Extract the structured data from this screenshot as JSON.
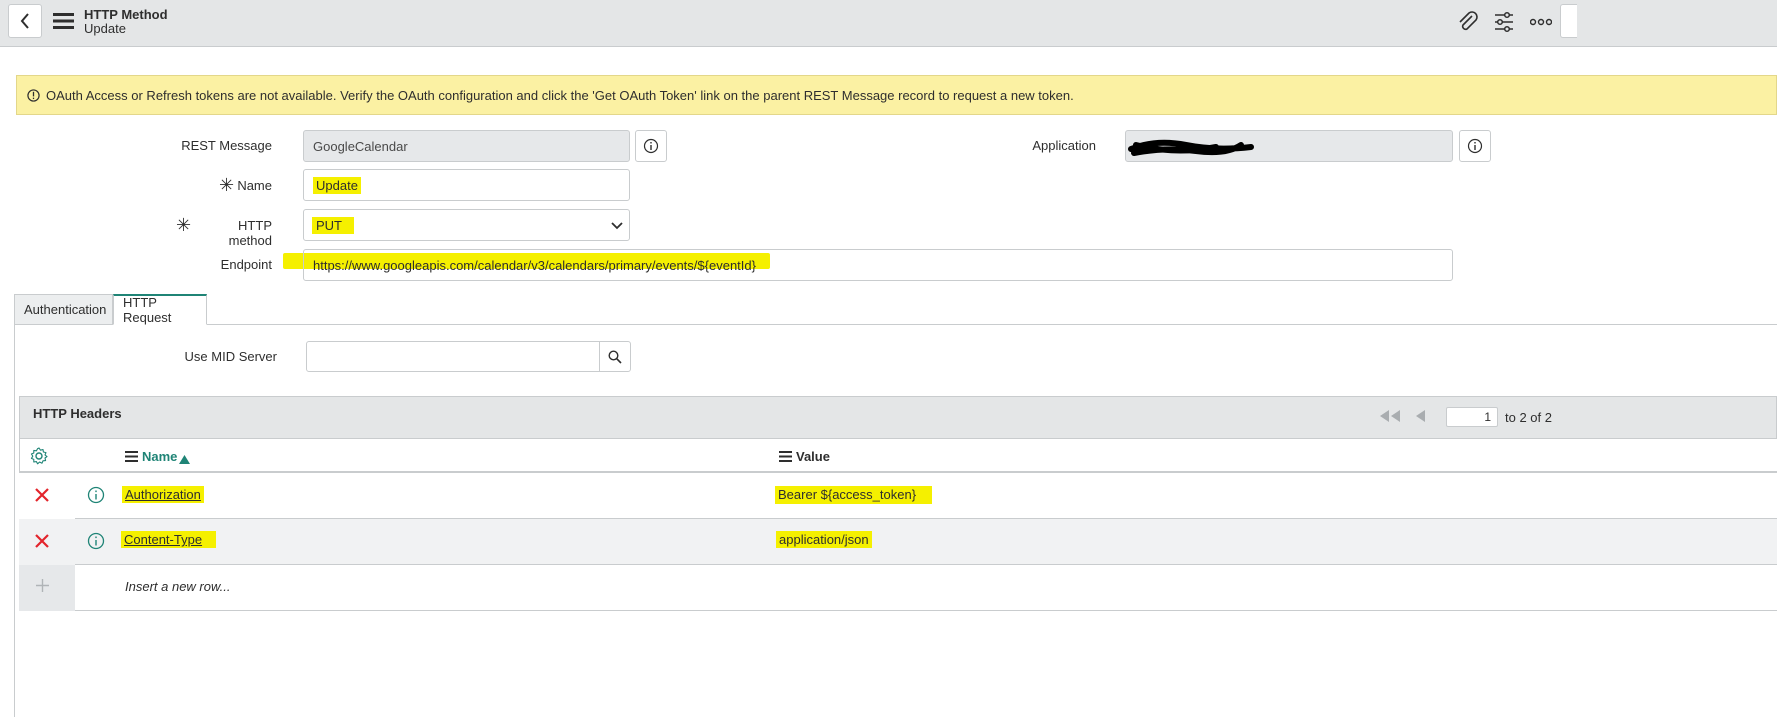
{
  "header": {
    "title": "HTTP Method",
    "subtitle": "Update",
    "icons": [
      "back-icon",
      "hamburger-icon",
      "paperclip-icon",
      "sliders-icon",
      "more-icon"
    ]
  },
  "alert": {
    "text": "OAuth Access or Refresh tokens are not available. Verify the OAuth configuration and click the 'Get OAuth Token' link on the parent REST Message record to request a new token."
  },
  "form": {
    "rest_message_label": "REST Message",
    "rest_message_value": "GoogleCalendar",
    "application_label": "Application",
    "application_value": "",
    "name_label": "Name",
    "name_value": "Update",
    "http_method_label": "HTTP method",
    "http_method_value": "PUT",
    "endpoint_label": "Endpoint",
    "endpoint_value": "https://www.googleapis.com/calendar/v3/calendars/primary/events/${eventId}"
  },
  "tabs": [
    {
      "label": "Authentication",
      "active": false
    },
    {
      "label": "HTTP Request",
      "active": true
    }
  ],
  "http_request": {
    "mid_server_label": "Use MID Server",
    "mid_server_value": ""
  },
  "headers_list": {
    "title": "HTTP Headers",
    "pager": {
      "page": "1",
      "range_text": "to 2 of 2"
    },
    "columns": {
      "name": "Name",
      "value": "Value"
    },
    "rows": [
      {
        "name": "Authorization",
        "value": "Bearer ${access_token}"
      },
      {
        "name": "Content-Type",
        "value": "application/json"
      }
    ],
    "insert_placeholder": "Insert a new row..."
  },
  "colors": {
    "highlight": "#f5f000",
    "alert_bg": "#fbf1a3",
    "delete_red": "#e3242b",
    "teal": "#1f8476"
  }
}
